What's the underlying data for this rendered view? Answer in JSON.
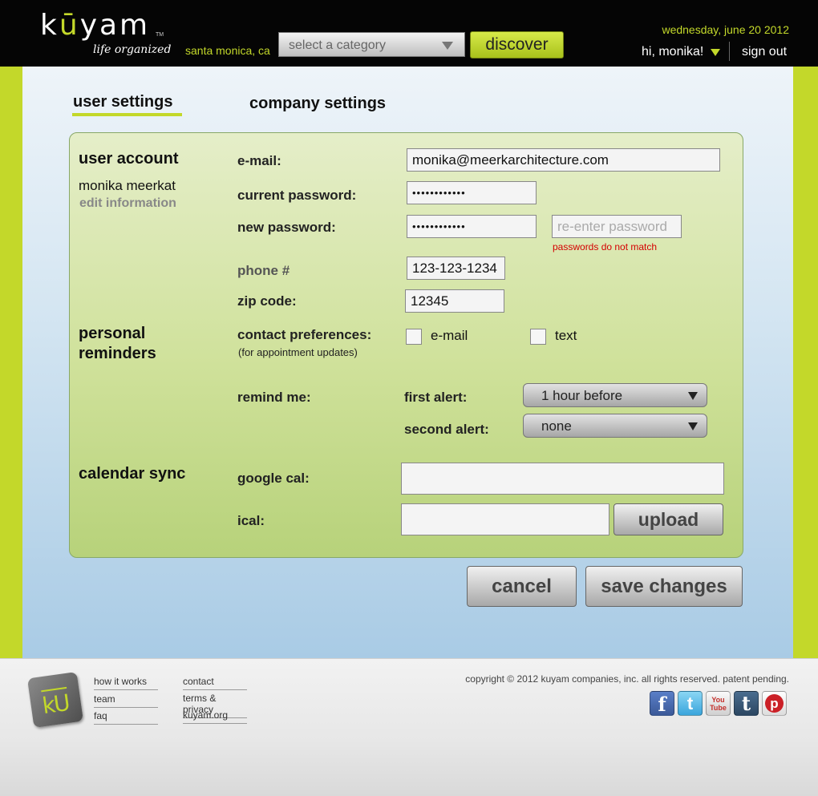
{
  "header": {
    "logo_word_prefix": "k",
    "logo_word_u": "ū",
    "logo_word_suffix": "yam",
    "logo_tm": "TM",
    "logo_tagline": "life organized",
    "location": "santa monica, ca",
    "category_select": "select a category",
    "discover_label": "discover",
    "date": "wednesday, june 20 2012",
    "greeting": "hi, monika!",
    "signout_label": "sign out"
  },
  "tabs": {
    "user_settings": "user settings",
    "company_settings": "company settings"
  },
  "user_account": {
    "heading": "user account",
    "name": "monika meerkat",
    "edit_label": "edit information",
    "email_label": "e-mail:",
    "email_value": "monika@meerkarchitecture.com",
    "current_password_label": "current password:",
    "current_password_value": "••••••••••••",
    "new_password_label": "new password:",
    "new_password_value": "••••••••••••",
    "reenter_placeholder": "re-enter password",
    "password_error": "passwords do not match",
    "phone_label": "phone #",
    "phone_value": "123-123-1234",
    "zip_label": "zip code:",
    "zip_value": "12345"
  },
  "reminders": {
    "heading_line1": "personal",
    "heading_line2": "reminders",
    "contact_label": "contact preferences:",
    "contact_sublabel": "(for appointment updates)",
    "email_option": "e-mail",
    "text_option": "text",
    "remind_label": "remind me:",
    "first_alert_label": "first alert:",
    "first_alert_value": "1 hour before",
    "second_alert_label": "second alert:",
    "second_alert_value": "none"
  },
  "calendar": {
    "heading": "calendar sync",
    "google_label": "google cal:",
    "google_value": "",
    "ical_label": "ical:",
    "ical_value": "",
    "upload_label": "upload"
  },
  "actions": {
    "cancel_label": "cancel",
    "save_label": "save changes"
  },
  "footer": {
    "logo_letters": "kU",
    "links_col1": [
      "how it works",
      "team",
      "faq"
    ],
    "links_col2": [
      "contact",
      "terms & privacy",
      "kuyam.org"
    ],
    "copyright": "copyright © 2012 kuyam companies, inc. all rights reserved. patent pending.",
    "social": [
      {
        "icon": "facebook-icon",
        "glyph": "f",
        "color": "#3b5998"
      },
      {
        "icon": "twitter-icon",
        "glyph": "t",
        "color": "#4ab3e6"
      },
      {
        "icon": "youtube-icon",
        "glyph": "You Tube",
        "color": "#e8e8e8"
      },
      {
        "icon": "tumblr-icon",
        "glyph": "t",
        "color": "#34526f"
      },
      {
        "icon": "pinterest-icon",
        "glyph": "p",
        "color": "#f3f3f3"
      }
    ]
  },
  "colors": {
    "accent_green": "#c3d82a",
    "header_bg": "#050505",
    "error_red": "#d40000"
  }
}
